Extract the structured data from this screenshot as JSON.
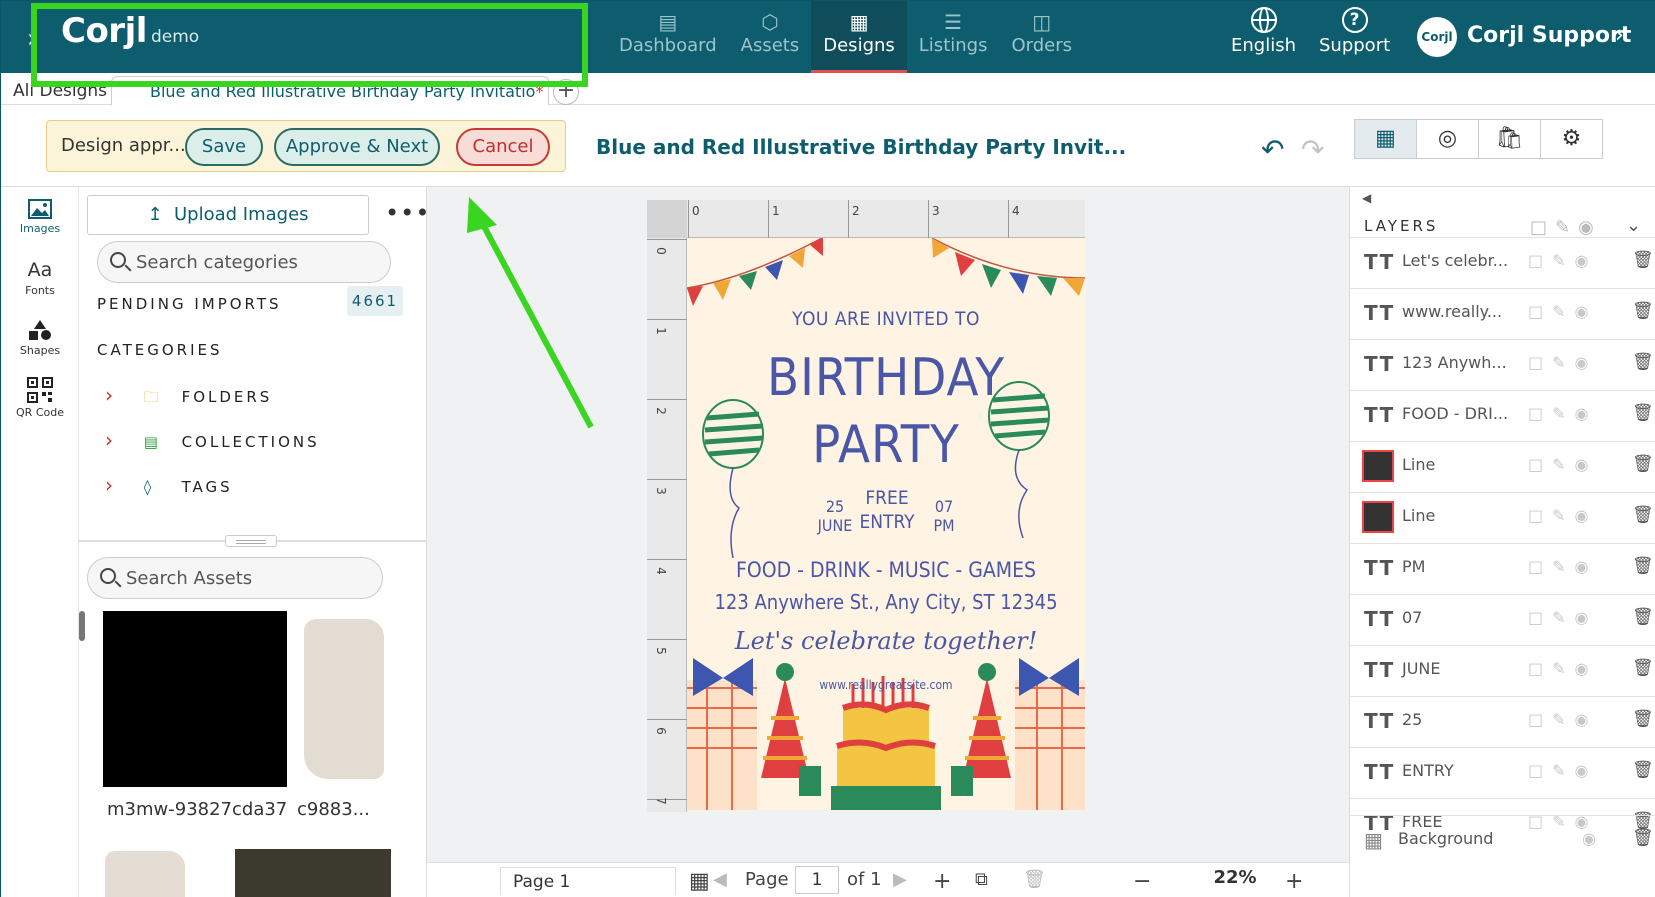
{
  "topbar": {
    "logo": "Corjl",
    "env": "demo",
    "nav": [
      {
        "label": "Dashboard",
        "icon": "dashboard-icon",
        "active": false
      },
      {
        "label": "Assets",
        "icon": "assets-icon",
        "active": false
      },
      {
        "label": "Designs",
        "icon": "designs-icon",
        "active": true
      },
      {
        "label": "Listings",
        "icon": "listings-icon",
        "active": false
      },
      {
        "label": "Orders",
        "icon": "orders-icon",
        "active": false
      }
    ],
    "language": "English",
    "support": "Support",
    "avatar_text": "Corjl",
    "user": "Corjl Support"
  },
  "tabs": {
    "all": "All Designs",
    "current": "Blue and Red Illustrative Birthday Party Invitatio",
    "unsaved_marker": "*"
  },
  "toolbar": {
    "approval_label": "Design appr...",
    "save": "Save",
    "approve_next": "Approve & Next",
    "cancel": "Cancel",
    "design_title": "Blue and Red Illustrative Birthday Party Invit..."
  },
  "rail": [
    {
      "label": "Images",
      "icon": "image-icon",
      "active": true
    },
    {
      "label": "Fonts",
      "icon": "fonts-icon",
      "active": false
    },
    {
      "label": "Shapes",
      "icon": "shapes-icon",
      "active": false
    },
    {
      "label": "QR Code",
      "icon": "qr-code-icon",
      "active": false
    }
  ],
  "panel": {
    "upload": "Upload Images",
    "search_categories": "Search categories",
    "pending_imports": "PENDING IMPORTS",
    "pending_count": "4661",
    "categories": "CATEGORIES",
    "cat_items": [
      "FOLDERS",
      "COLLECTIONS",
      "TAGS"
    ],
    "search_assets": "Search Assets",
    "assets": [
      "m3mw-93827cda37",
      "c9883..."
    ]
  },
  "ruler": {
    "top": [
      "0",
      "1",
      "2",
      "3",
      "4"
    ],
    "left": [
      "0",
      "1",
      "2",
      "3",
      "4",
      "5",
      "6",
      "7"
    ]
  },
  "card": {
    "invited": "YOU ARE INVITED TO",
    "birthday": "BIRTHDAY",
    "party": "PARTY",
    "day": "25",
    "month": "JUNE",
    "free": "FREE",
    "entry": "ENTRY",
    "hour": "07",
    "ampm": "PM",
    "activities": "FOOD - DRINK - MUSIC - GAMES",
    "address": "123 Anywhere St., Any City, ST 12345",
    "script": "Let's celebrate together!",
    "website": "www.reallygreatsite.com"
  },
  "bottombar": {
    "page_tab": "Page 1",
    "page_label": "Page",
    "page_num": "1",
    "of": "of 1",
    "zoom": "22%"
  },
  "layers": {
    "title": "LAYERS",
    "items": [
      {
        "name": "Let's celebr...",
        "type": "text"
      },
      {
        "name": "www.really...",
        "type": "text"
      },
      {
        "name": "123 Anywh...",
        "type": "text"
      },
      {
        "name": "FOOD - DRI...",
        "type": "text"
      },
      {
        "name": "Line",
        "type": "shape"
      },
      {
        "name": "Line",
        "type": "shape"
      },
      {
        "name": "PM",
        "type": "text"
      },
      {
        "name": "07",
        "type": "text"
      },
      {
        "name": "JUNE",
        "type": "text"
      },
      {
        "name": "25",
        "type": "text"
      },
      {
        "name": "ENTRY",
        "type": "text"
      },
      {
        "name": "FREE",
        "type": "text"
      }
    ],
    "background": "Background"
  },
  "colors": {
    "brand": "#0e5d6e",
    "highlight": "#3ad520",
    "cancel": "#c0302c",
    "card_bg": "#fff4e4",
    "card_text": "#4a56a6"
  }
}
